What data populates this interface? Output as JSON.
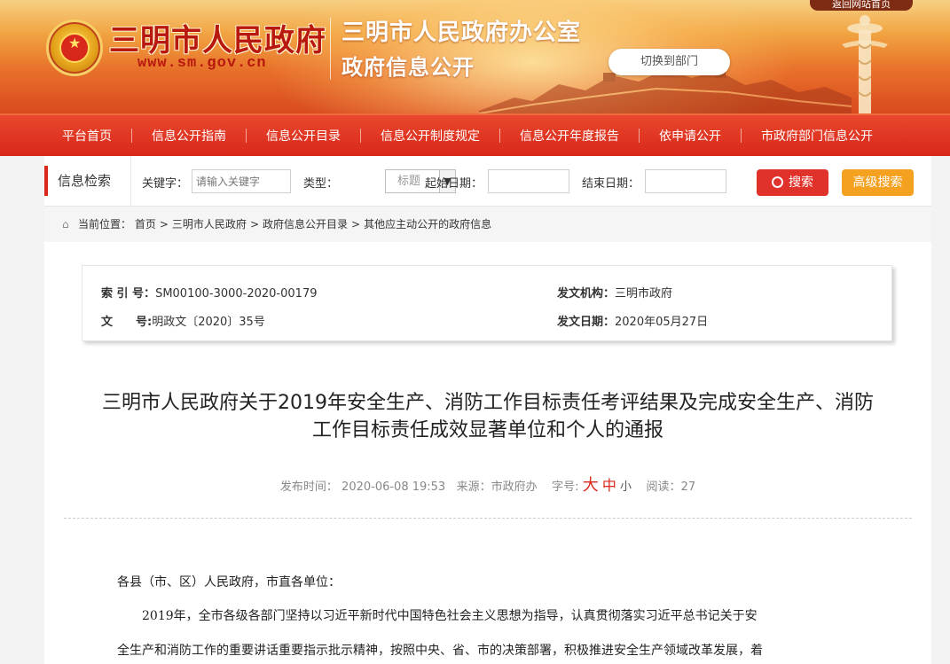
{
  "header": {
    "site_name": "三明市人民政府",
    "site_url": "www.sm.gov.cn",
    "office_name": "三明市人民政府办公室",
    "office_sub": "政府信息公开",
    "switch_label": "切换到部门",
    "back_label": "返回网站首页"
  },
  "nav": {
    "items": [
      "平台首页",
      "信息公开指南",
      "信息公开目录",
      "信息公开制度规定",
      "信息公开年度报告",
      "依申请公开",
      "市政府部门信息公开"
    ]
  },
  "search": {
    "title": "信息检索",
    "keyword_label": "关键字：",
    "keyword_placeholder": "请输入关键字",
    "type_label": "类型：",
    "type_value": "标题",
    "start_label": "起始日期：",
    "end_label": "结束日期：",
    "search_button": "搜索",
    "advanced_button": "高级搜索"
  },
  "breadcrumb": {
    "prefix": "当前位置：",
    "items": [
      "首页",
      "三明市人民政府",
      "政府信息公开目录",
      "其他应主动公开的政府信息"
    ]
  },
  "meta": {
    "index_label": "索 引 号：",
    "index_value": "SM00100-3000-2020-00179",
    "doc_no_label": "文　　号:",
    "doc_no_value": "明政文〔2020〕35号",
    "issuer_label": "发文机构：",
    "issuer_value": "三明市政府",
    "date_label": "发文日期：",
    "date_value": "2020年05月27日"
  },
  "article": {
    "title_line1": "三明市人民政府关于2019年安全生产、消防工作目标责任考评结果及完成安全生产、消防",
    "title_line2": "工作目标责任成效显著单位和个人的通报",
    "publish_label": "发布时间：",
    "publish_time": "2020-06-08 19:53",
    "source_label": "来源：",
    "source_value": "市政府办",
    "font_label": "字号:",
    "font_big": "大",
    "font_mid": "中",
    "font_small": "小",
    "reads_label": "阅读：",
    "reads_value": "27",
    "para1": "各县（市、区）人民政府，市直各单位：",
    "para2_line1": "　　2019年，全市各级各部门坚持以习近平新时代中国特色社会主义思想为指导，认真贯彻落实习近平总书记关于安",
    "para2_line2": "全生产和消防工作的重要讲话重要指示批示精神，按照中央、省、市的决策部署，积极推进安全生产领域改革发展，着"
  }
}
